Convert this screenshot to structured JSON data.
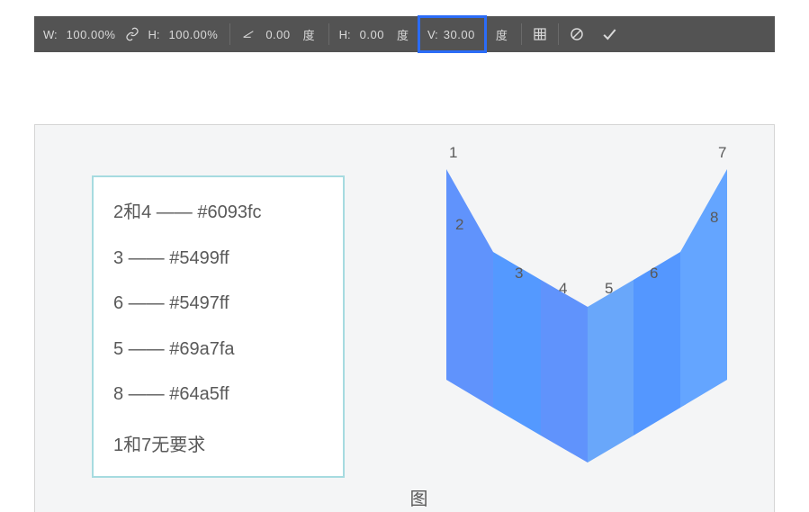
{
  "toolbar": {
    "w_label": "W:",
    "w_value": "100.00%",
    "h_label": "H:",
    "h_value": "100.00%",
    "angle_value": "0.00",
    "angle_unit": "度",
    "H2_label": "H:",
    "H2_value": "0.00",
    "H2_unit": "度",
    "V_label": "V:",
    "V_value": "30.00",
    "V_unit": "度",
    "icons": {
      "link": "link-icon",
      "shear": "shear-icon",
      "warp": "warp-icon",
      "cancel": "cancel-icon",
      "commit": "commit-icon"
    }
  },
  "legend": {
    "row1": "2和4 —— #6093fc",
    "row2": "3 —— #5499ff",
    "row3": "6 —— #5497ff",
    "row4": "5 —— #69a7fa",
    "row5": "8 —— #64a5ff",
    "row6": "1和7无要求"
  },
  "shape": {
    "colors": {
      "2": "#6093fc",
      "3": "#5499ff",
      "4": "#6093fc",
      "5": "#69a7fa",
      "6": "#5497ff",
      "8": "#64a5ff"
    },
    "labels": {
      "1": "1",
      "2": "2",
      "3": "3",
      "4": "4",
      "5": "5",
      "6": "6",
      "7": "7",
      "8": "8"
    }
  },
  "caption": "图"
}
